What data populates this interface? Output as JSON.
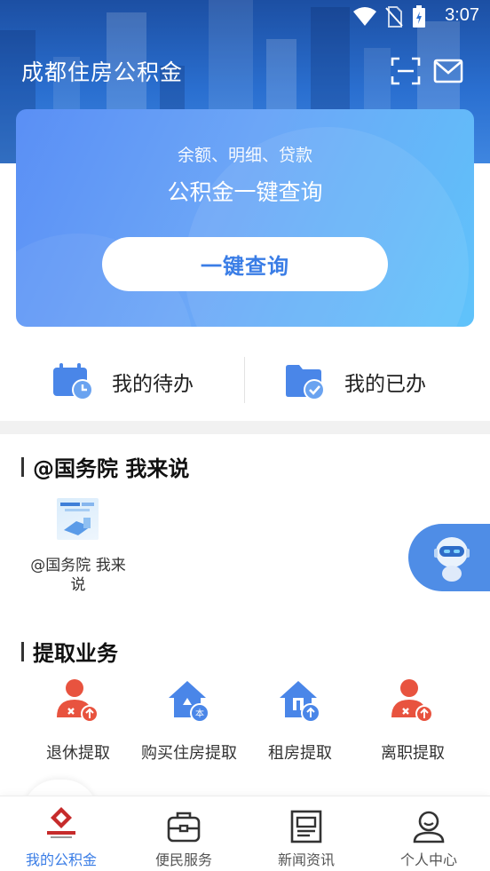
{
  "status_bar": {
    "time": "3:07"
  },
  "header": {
    "title": "成都住房公积金"
  },
  "query_card": {
    "subtitle": "余额、明细、贷款",
    "title": "公积金一键查询",
    "button_label": "一键查询"
  },
  "tasks": {
    "todo_label": "我的待办",
    "done_label": "我的已办"
  },
  "section_gwy": {
    "title": "@国务院 我来说",
    "items": [
      {
        "label": "@国务院 我来说"
      }
    ]
  },
  "section_withdraw": {
    "title": "提取业务",
    "items": [
      {
        "label": "退休提取",
        "icon": "retire-withdraw-icon"
      },
      {
        "label": "购买住房提取",
        "icon": "house-purchase-icon"
      },
      {
        "label": "租房提取",
        "icon": "rent-icon"
      },
      {
        "label": "离职提取",
        "icon": "resign-withdraw-icon"
      }
    ]
  },
  "bottom_nav": {
    "items": [
      {
        "label": "我的公积金",
        "active": true
      },
      {
        "label": "便民服务"
      },
      {
        "label": "新闻资讯"
      },
      {
        "label": "个人中心"
      }
    ]
  },
  "colors": {
    "accent": "#3a7de6",
    "header_blue": "#2a6fd0",
    "icon_red": "#e8533f"
  }
}
